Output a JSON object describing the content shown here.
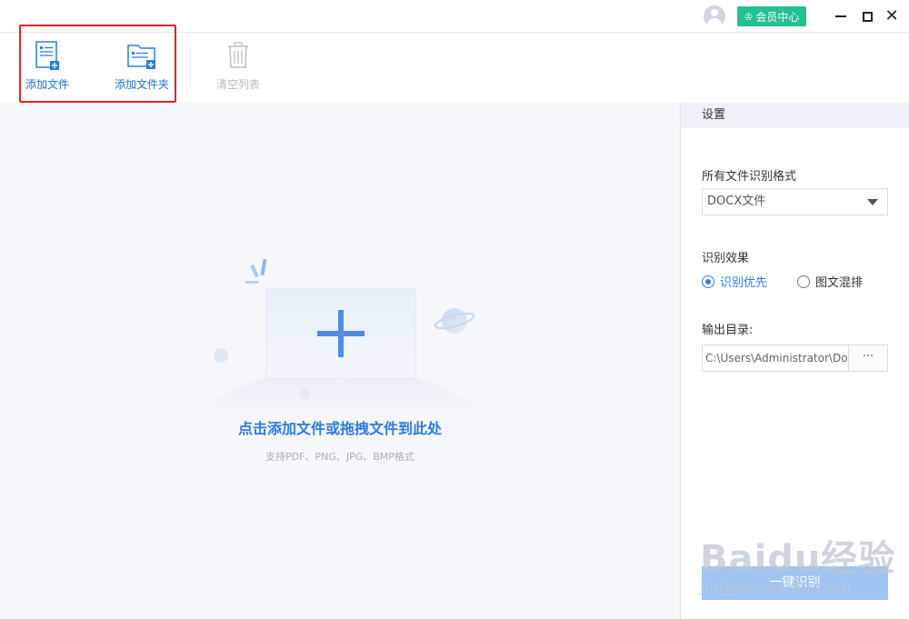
{
  "titlebar": {
    "vip_label": "会员中心",
    "icons": [
      "avatar-icon",
      "crown-icon",
      "minimize-icon",
      "maximize-icon",
      "close-icon"
    ],
    "close_glyph": "✕"
  },
  "toolbar": {
    "add_file": "添加文件",
    "add_folder": "添加文件夹",
    "clear_list": "清空列表"
  },
  "drop_area": {
    "title": "点击添加文件或拖拽文件到此处",
    "subtitle": "支持PDF、PNG、JPG、BMP格式"
  },
  "settings": {
    "header": "设置",
    "format_label": "所有文件识别格式",
    "format_value": "DOCX文件",
    "effect_label": "识别效果",
    "effect_options": [
      "识别优先",
      "图文混排"
    ],
    "effect_selected": "识别优先",
    "output_label": "输出目录:",
    "output_path": "C:\\Users\\Administrator\\Documents",
    "browse_label": "···",
    "start_label": "一键识别"
  },
  "watermark": {
    "big": "Baidu经验",
    "small": "jingyan.baidu.com"
  },
  "colors": {
    "accent": "#2c7be5",
    "vip_green": "#21c193",
    "highlight_red": "#e8211c",
    "start_button": "#9fc4f2"
  }
}
